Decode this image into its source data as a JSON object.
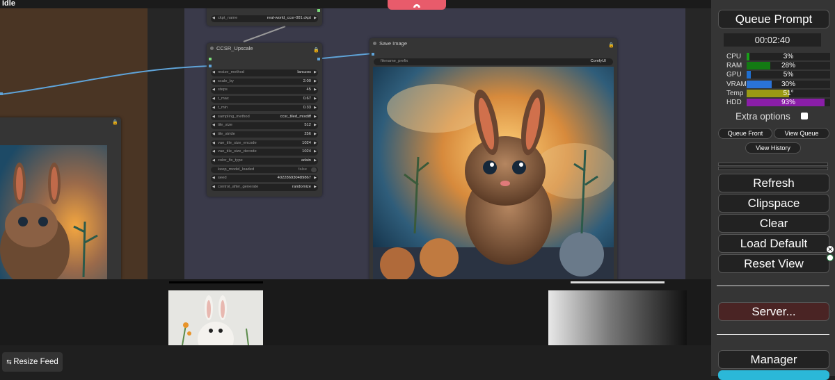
{
  "status": {
    "text": "Idle"
  },
  "nodes": {
    "ckpt": {
      "label": "ckpt_name",
      "value": "real-world_ccsr-001.ckpt"
    },
    "ccsr": {
      "title": "CCSR_Upscale",
      "widgets": [
        {
          "label": "resize_method",
          "value": "lanczos"
        },
        {
          "label": "scale_by",
          "value": "2.00"
        },
        {
          "label": "steps",
          "value": "45"
        },
        {
          "label": "t_max",
          "value": "0.67"
        },
        {
          "label": "t_min",
          "value": "0.33"
        },
        {
          "label": "sampling_method",
          "value": "ccsr_tiled_mixdiff"
        },
        {
          "label": "tile_size",
          "value": "512"
        },
        {
          "label": "tile_stride",
          "value": "256"
        },
        {
          "label": "vae_tile_size_encode",
          "value": "1024"
        },
        {
          "label": "vae_tile_size_decode",
          "value": "1024"
        },
        {
          "label": "color_fix_type",
          "value": "adain"
        },
        {
          "label": "keep_model_loaded",
          "value": "false"
        },
        {
          "label": "seed",
          "value": "402286930489867"
        },
        {
          "label": "control_after_generate",
          "value": "randomize"
        }
      ]
    },
    "save": {
      "title": "Save Image",
      "prefix_label": "filename_prefix",
      "prefix_value": "ComfyUI"
    }
  },
  "feed": {
    "resize_label": "Resize Feed"
  },
  "panel": {
    "queue_prompt": "Queue Prompt",
    "timer": "00:02:40",
    "stats": [
      {
        "label": "CPU",
        "value": "3%",
        "fraction": 0.03,
        "color": "#1a9e1a"
      },
      {
        "label": "RAM",
        "value": "28%",
        "fraction": 0.28,
        "color": "#137a13"
      },
      {
        "label": "GPU",
        "value": "5%",
        "fraction": 0.05,
        "color": "#1f6fd1"
      },
      {
        "label": "VRAM",
        "value": "30%",
        "fraction": 0.3,
        "color": "#2a73d8"
      },
      {
        "label": "Temp",
        "value": "51°",
        "fraction": 0.51,
        "color": "#9a9a14"
      },
      {
        "label": "HDD",
        "value": "93%",
        "fraction": 0.93,
        "color": "#8a1ea8"
      }
    ],
    "extra_options": "Extra options",
    "queue_front": "Queue Front",
    "view_queue": "View Queue",
    "view_history": "View History",
    "refresh": "Refresh",
    "clipspace": "Clipspace",
    "clear": "Clear",
    "load_default": "Load Default",
    "reset_view": "Reset View",
    "server": "Server...",
    "manager": "Manager"
  }
}
